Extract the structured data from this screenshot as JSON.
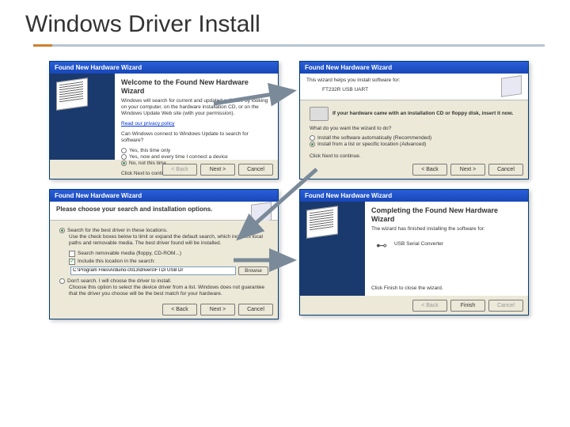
{
  "slide": {
    "title": "Windows Driver Install"
  },
  "dlg1": {
    "titlebar": "Found New Hardware Wizard",
    "heading": "Welcome to the Found New Hardware Wizard",
    "intro": "Windows will search for current and updated software by looking on your computer, on the hardware installation CD, or on the Windows Update Web site (with your permission).",
    "privacy": "Read our privacy policy",
    "question": "Can Windows connect to Windows Update to search for software?",
    "opt1": "Yes, this time only",
    "opt2": "Yes, now and every time I connect a device",
    "opt3": "No, not this time",
    "hint": "Click Next to continue.",
    "back": "< Back",
    "next": "Next >",
    "cancel": "Cancel"
  },
  "dlg2": {
    "titlebar": "Found New Hardware Wizard",
    "lead": "This wizard helps you install software for:",
    "device": "FT232R USB UART",
    "cdline": "If your hardware came with an installation CD or floppy disk, insert it now.",
    "question": "What do you want the wizard to do?",
    "opt1": "Install the software automatically (Recommended)",
    "opt2": "Install from a list or specific location (Advanced)",
    "hint": "Click Next to continue.",
    "back": "< Back",
    "next": "Next >",
    "cancel": "Cancel"
  },
  "dlg3": {
    "titlebar": "Found New Hardware Wizard",
    "heading": "Please choose your search and installation options.",
    "opt_search": "Search for the best driver in these locations.",
    "search_help": "Use the check boxes below to limit or expand the default search, which includes local paths and removable media. The best driver found will be installed.",
    "chk_removable": "Search removable media (floppy, CD-ROM...)",
    "chk_include": "Include this location in the search:",
    "path": "C:\\Program Files\\Arduino-0013\\drivers\\FTDI USB Dr",
    "browse": "Browse",
    "opt_dont": "Don't search. I will choose the driver to install.",
    "dont_help": "Choose this option to select the device driver from a list. Windows does not guarantee that the driver you choose will be the best match for your hardware.",
    "back": "< Back",
    "next": "Next >",
    "cancel": "Cancel"
  },
  "dlg4": {
    "titlebar": "Found New Hardware Wizard",
    "heading": "Completing the Found New Hardware Wizard",
    "lead": "The wizard has finished installing the software for:",
    "device": "USB Serial Converter",
    "hint": "Click Finish to close the wizard.",
    "back": "< Back",
    "finish": "Finish",
    "cancel": "Cancel"
  }
}
